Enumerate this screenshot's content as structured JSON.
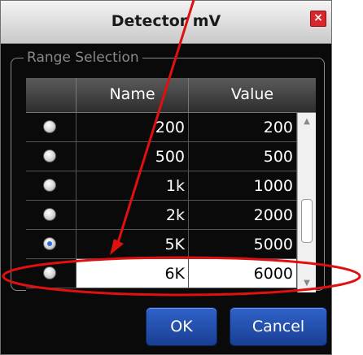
{
  "dialog": {
    "title": "Detector mV",
    "close_label": "×"
  },
  "group": {
    "label": "Range Selection"
  },
  "table": {
    "columns": [
      "Name",
      "Value"
    ],
    "rows": [
      {
        "name": "200",
        "value": "200",
        "selected": false
      },
      {
        "name": "500",
        "value": "500",
        "selected": false
      },
      {
        "name": "1k",
        "value": "1000",
        "selected": false
      },
      {
        "name": "2k",
        "value": "2000",
        "selected": false
      },
      {
        "name": "5K",
        "value": "5000",
        "selected": true
      },
      {
        "name": "6K",
        "value": "6000",
        "selected": false,
        "editing": true
      }
    ]
  },
  "buttons": {
    "ok_label": "OK",
    "cancel_label": "Cancel"
  },
  "annotation": {
    "color": "#e01010"
  }
}
